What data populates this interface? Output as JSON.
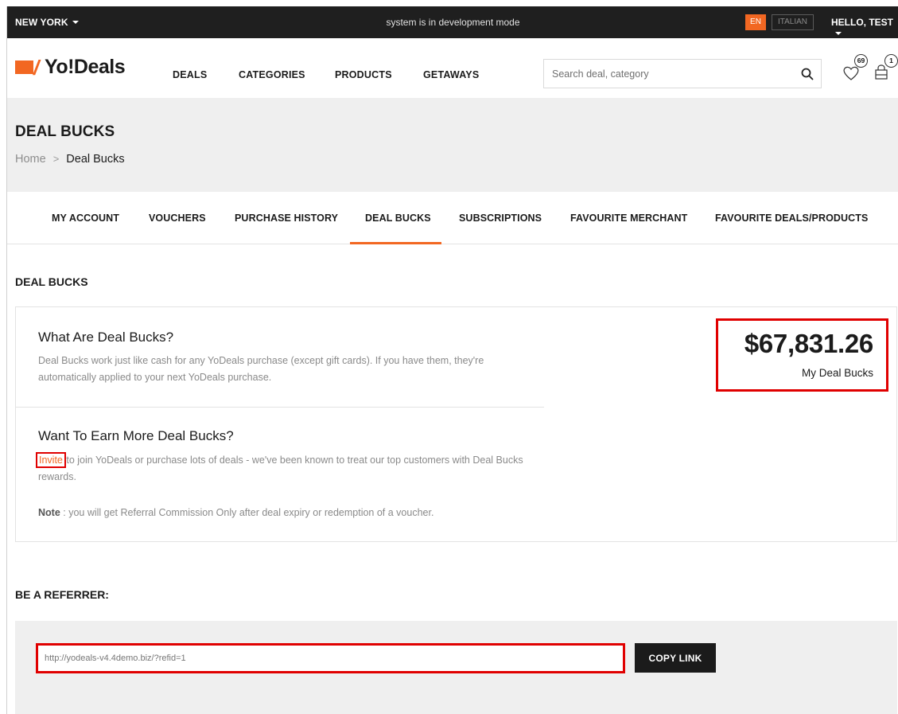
{
  "topbar": {
    "city": "NEW YORK",
    "dev_mode": "system is in development mode",
    "lang_en": "EN",
    "lang_it": "ITALIAN",
    "greeting": "HELLO, TEST"
  },
  "header": {
    "logo_text": "Yo!Deals",
    "nav": [
      "DEALS",
      "CATEGORIES",
      "PRODUCTS",
      "GETAWAYS"
    ],
    "search_placeholder": "Search deal, category",
    "wishlist_count": "69",
    "cart_count": "1",
    "accent_color": "#f26722"
  },
  "banner": {
    "title": "DEAL BUCKS",
    "breadcrumb_home": "Home",
    "breadcrumb_current": "Deal Bucks"
  },
  "tabs": [
    "MY ACCOUNT",
    "VOUCHERS",
    "PURCHASE HISTORY",
    "DEAL BUCKS",
    "SUBSCRIPTIONS",
    "FAVOURITE MERCHANT",
    "FAVOURITE DEALS/PRODUCTS"
  ],
  "active_tab": "DEAL BUCKS",
  "section_title": "DEAL BUCKS",
  "card": {
    "what_heading": "What Are Deal Bucks?",
    "what_text": "Deal Bucks work just like cash for any YoDeals purchase (except gift cards). If you have them, they're automatically applied to your next YoDeals purchase.",
    "earn_heading": "Want To Earn More Deal Bucks?",
    "invite_link": "Invite",
    "earn_text": " to join YoDeals or purchase lots of deals - we've been known to treat our top customers with Deal Bucks rewards.",
    "note_label": "Note",
    "note_text": " : you will get Referral Commission Only after deal expiry or redemption of a voucher.",
    "balance_amount": "$67,831.26",
    "balance_label": "My Deal Bucks"
  },
  "referrer": {
    "title": "BE A REFERRER:",
    "link": "http://yodeals-v4.4demo.biz/?refid=1",
    "copy_button": "COPY LINK"
  }
}
